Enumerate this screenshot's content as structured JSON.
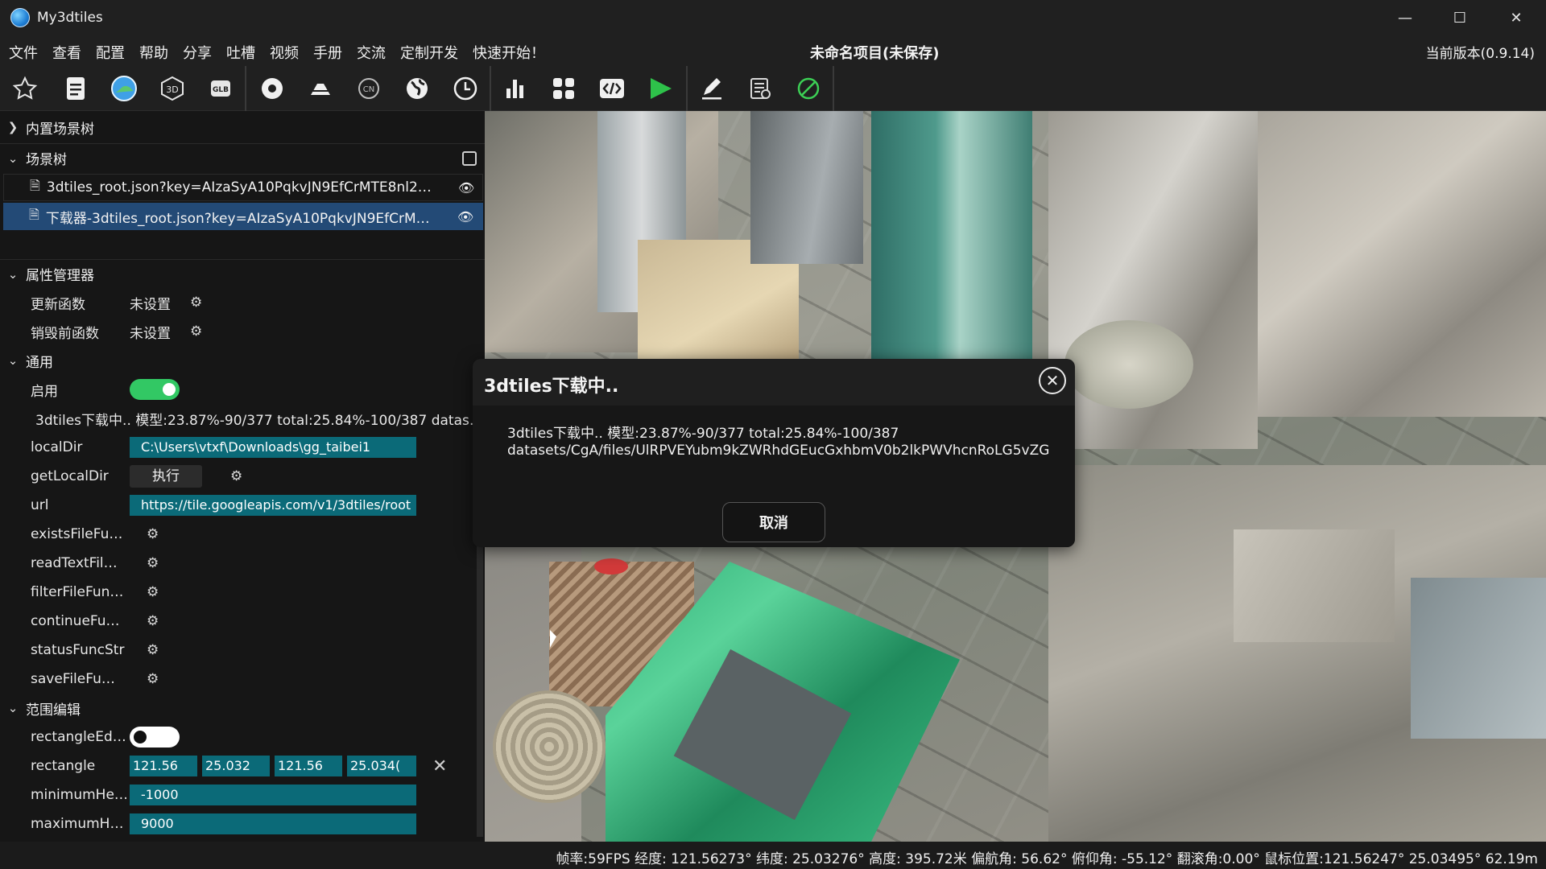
{
  "window": {
    "title": "My3dtiles",
    "minimize": "—",
    "maximize": "☐",
    "close": "✕"
  },
  "menu": {
    "items": [
      "文件",
      "查看",
      "配置",
      "帮助",
      "分享",
      "吐槽",
      "视频",
      "手册",
      "交流",
      "定制开发",
      "快速开始！"
    ],
    "project_title": "未命名项目(未保存)",
    "version": "当前版本(0.9.14)"
  },
  "toolbar": {
    "icons": [
      "star-icon",
      "document-icon",
      "earth-logo-icon",
      "3d-icon",
      "glb-icon",
      "target-icon",
      "terrain-icon",
      "cn-icon",
      "globe-icon",
      "clock-icon",
      "bar-chart-icon",
      "grid-icon",
      "code-icon",
      "play-icon",
      "pen-icon",
      "list-icon",
      "disable-icon"
    ],
    "label_3d": "3D",
    "label_glb": "GLB",
    "label_cn": "CN"
  },
  "left": {
    "builtin_tree": "内置场景树",
    "scene_tree": "场景树",
    "tree_items": [
      "3dtiles_root.json?key=AIzaSyA10PqkvJN9EfCrMTE8nl2…",
      "下载器-3dtiles_root.json?key=AIzaSyA10PqkvJN9EfCrM…"
    ],
    "props_title": "属性管理器",
    "update_fn_label": "更新函数",
    "update_fn_value": "未设置",
    "destroy_fn_label": "销毁前函数",
    "destroy_fn_value": "未设置",
    "general_title": "通用",
    "enable_label": "启用",
    "progress_text": "3dtiles下载中.. 模型:23.87%-90/377 total:25.84%-100/387 datas…",
    "localdir_label": "localDir",
    "localdir_value": "C:\\Users\\vtxf\\Downloads\\gg_taibei1",
    "getlocaldir_label": "getLocalDir",
    "exec_label": "执行",
    "url_label": "url",
    "url_value": "https://tile.googleapis.com/v1/3dtiles/root",
    "func_labels": [
      "existsFileFu…",
      "readTextFil…",
      "filterFileFun…",
      "continueFu…",
      "statusFuncStr",
      "saveFileFu…"
    ],
    "range_title": "范围编辑",
    "rect_edit_label": "rectangleEd…",
    "rectangle_label": "rectangle",
    "rectangle_values": [
      "121.56",
      "25.032",
      "121.56",
      "25.034("
    ],
    "minh_label": "minimumHe…",
    "minh_value": "-1000",
    "maxh_label": "maximumH…",
    "maxh_value": "9000"
  },
  "modal": {
    "title": "3dtiles下载中..",
    "line1": "3dtiles下载中.. 模型:23.87%-90/377 total:25.84%-100/387",
    "line2": "datasets/CgA/files/UlRPVEYubm9kZWRhdGEucGxhbmV0b2lkPWVhcnRoLG5vZG",
    "cancel": "取消"
  },
  "status": {
    "text": "帧率:59FPS 经度: 121.56273° 纬度: 25.03276° 高度: 395.72米 偏航角: 56.62° 俯仰角: -55.12° 翻滚角:0.00° 鼠标位置:121.56247° 25.03495° 62.19m"
  },
  "colors": {
    "accent_green": "#32c864",
    "field_teal": "#0b6a78",
    "selection": "#234a76"
  }
}
